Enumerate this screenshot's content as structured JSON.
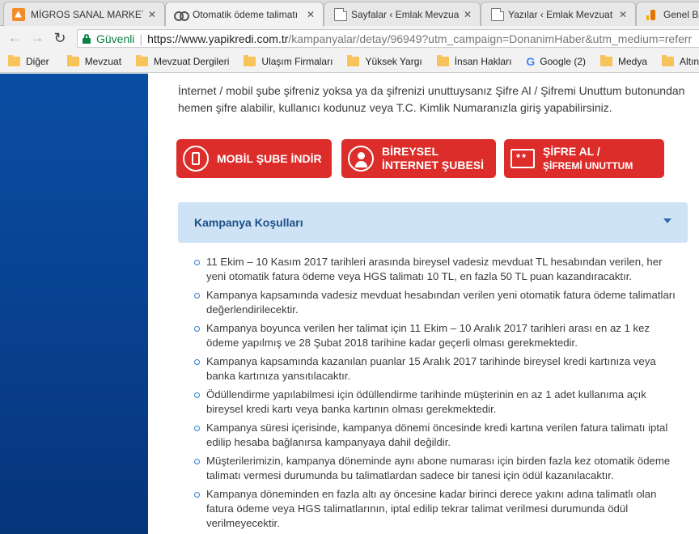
{
  "tabs": [
    {
      "title": "MİGROS SANAL MARKET",
      "icon": "migros-icon"
    },
    {
      "title": "Otomatik ödeme talimatı",
      "icon": "yapikredi-icon"
    },
    {
      "title": "Sayfalar ‹ Emlak Mevzuat",
      "icon": "page-icon"
    },
    {
      "title": "Yazılar ‹ Emlak Mevzuat",
      "icon": "page-icon"
    },
    {
      "title": "Genel Bak",
      "icon": "analytics-icon"
    }
  ],
  "tab_close": "✕",
  "address": {
    "secure_label": "Güvenli",
    "host": "https://www.yapikredi.com.tr",
    "path": "/kampanyalar/detay/96949?utm_campaign=DonanimHaber&utm_medium=referr"
  },
  "bookmarks": [
    {
      "label": "Diğer"
    },
    {
      "label": "Mevzuat"
    },
    {
      "label": "Mevzuat Dergileri"
    },
    {
      "label": "Ulaşım Firmaları"
    },
    {
      "label": "Yüksek Yargı"
    },
    {
      "label": "İnsan Hakları"
    },
    {
      "label": "Google (2)",
      "google": true
    },
    {
      "label": "Medya"
    },
    {
      "label": "Altın"
    }
  ],
  "intro": "İnternet / mobil şube şifreniz yoksa ya da şifrenizi unuttuysanız Şifre Al / Şifremi Unuttum butonundan hemen şifre alabilir, kullanıcı kodunuz veya T.C. Kimlik Numaranızla giriş yapabilirsiniz.",
  "actions": {
    "mobile": "MOBİL ŞUBE İNDİR",
    "personal_1": "BİREYSEL",
    "personal_2": "İNTERNET ŞUBESİ",
    "password_1": "ŞİFRE AL /",
    "password_2": "ŞİFREMİ UNUTTUM"
  },
  "accordion_title": "Kampanya Koşulları",
  "terms": [
    "11 Ekim – 10 Kasım 2017 tarihleri arasında bireysel vadesiz mevduat TL hesabından verilen, her yeni otomatik fatura ödeme veya HGS talimatı 10 TL, en fazla 50 TL puan kazandıracaktır.",
    "Kampanya kapsamında vadesiz mevduat hesabından verilen yeni otomatik fatura ödeme talimatları değerlendirilecektir.",
    "Kampanya boyunca verilen her talimat için 11 Ekim – 10 Aralık 2017 tarihleri arası en az 1 kez ödeme yapılmış ve 28 Şubat 2018 tarihine kadar geçerli olması gerekmektedir.",
    "Kampanya kapsamında kazanılan puanlar 15 Aralık 2017 tarihinde bireysel kredi kartınıza veya banka kartınıza yansıtılacaktır.",
    "Ödüllendirme yapılabilmesi için ödüllendirme tarihinde müşterinin en az 1 adet kullanıma açık bireysel kredi kartı veya banka kartının olması gerekmektedir.",
    "Kampanya süresi içerisinde, kampanya dönemi öncesinde kredi kartına verilen fatura talimatı iptal edilip hesaba bağlanırsa kampanyaya dahil değildir.",
    "Müşterilerimizin, kampanya döneminde aynı abone numarası için birden fazla kez otomatik ödeme talimatı vermesi durumunda bu talimatlardan sadece bir tanesi için ödül kazanılacaktır.",
    "Kampanya döneminden en fazla altı ay öncesine kadar birinci derece yakını adına talimatlı olan fatura ödeme veya HGS talimatlarının, iptal edilip tekrar talimat verilmesi durumunda ödül verilmeyecektir."
  ],
  "colors": {
    "accent": "#dc2d2a",
    "panel": "#cfe3f6",
    "brand_blue": "#0a4ea3",
    "secure": "#0b8043"
  }
}
